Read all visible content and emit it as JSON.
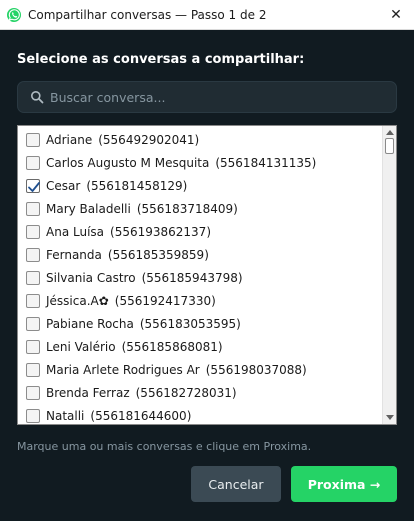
{
  "window": {
    "title": "Compartilhar conversas — Passo 1 de 2",
    "close_symbol": "✕",
    "app_icon": "whatsapp-logo-icon"
  },
  "heading": "Selecione as conversas a compartilhar:",
  "search": {
    "placeholder": "Buscar conversa...",
    "value": "",
    "icon": "search-icon"
  },
  "contacts": [
    {
      "name": "Adriane",
      "phone": "(556492902041)",
      "checked": false
    },
    {
      "name": "Carlos Augusto M Mesquita",
      "phone": "(556184131135)",
      "checked": false
    },
    {
      "name": "Cesar",
      "phone": "(556181458129)",
      "checked": true
    },
    {
      "name": "Mary Baladelli",
      "phone": "(556183718409)",
      "checked": false
    },
    {
      "name": "Ana Luísa",
      "phone": "(556193862137)",
      "checked": false
    },
    {
      "name": "Fernanda",
      "phone": "(556185359859)",
      "checked": false
    },
    {
      "name": "Silvania Castro",
      "phone": "(556185943798)",
      "checked": false
    },
    {
      "name": "Jéssica.A✿",
      "phone": "(556192417330)",
      "checked": false
    },
    {
      "name": "Pabiane Rocha",
      "phone": "(556183053595)",
      "checked": false
    },
    {
      "name": "Leni Valério",
      "phone": "(556185868081)",
      "checked": false
    },
    {
      "name": "Maria Arlete Rodrigues Ar",
      "phone": "(556198037088)",
      "checked": false
    },
    {
      "name": "Brenda Ferraz",
      "phone": "(556182728031)",
      "checked": false
    },
    {
      "name": "Natalli",
      "phone": "(556181644600)",
      "checked": false
    }
  ],
  "hint": "Marque uma ou mais conversas e clique em Proxima.",
  "buttons": {
    "cancel": "Cancelar",
    "next": "Proxima →"
  },
  "colors": {
    "background": "#111b21",
    "accent": "#25d366",
    "secondary_button": "#3b4a54",
    "search_bg": "#202c33"
  }
}
